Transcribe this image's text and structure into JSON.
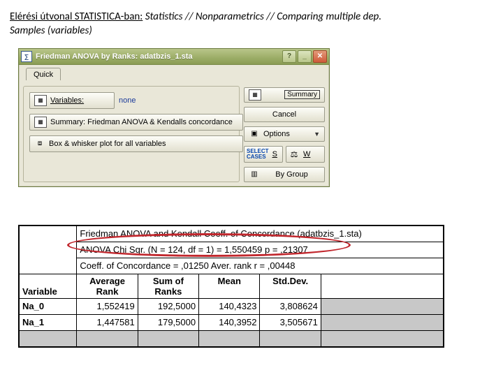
{
  "heading": {
    "lead": "Elérési útvonal STATISTICA-ban:",
    "path": " Statistics // Nonparametrics // Comparing multiple dep.",
    "path2": "Samples (variables)"
  },
  "dialog": {
    "title": "Friedman ANOVA by Ranks: adatbzis_1.sta",
    "tab": "Quick",
    "variables_btn": "Variables:",
    "variables_value": "none",
    "summary_btn": "Summary: Friedman ANOVA & Kendalls concordance",
    "whisker_btn": "Box & whisker plot for all variables",
    "right": {
      "summary": "Summary",
      "cancel": "Cancel",
      "options": "Options",
      "s": "S",
      "w": "W",
      "bygroup": "By Group"
    }
  },
  "results": {
    "title_line": "Friedman ANOVA and Kendall Coeff. of Concordance (adatbzis_1.sta)",
    "stat_line": "ANOVA Chi Sqr. (N = 124, df = 1) = 1,550459 p = ,21307",
    "coeff_line": "Coeff. of Concordance = ,01250 Aver. rank r = ,00448",
    "variable_label": "Variable",
    "columns": {
      "avg_rank1": "Average",
      "avg_rank2": "Rank",
      "sum1": "Sum of",
      "sum2": "Ranks",
      "mean": "Mean",
      "std": "Std.Dev."
    },
    "rows": [
      {
        "name": "Na_0",
        "avg_rank": "1,552419",
        "sum": "192,5000",
        "mean": "140,4323",
        "std": "3,808624"
      },
      {
        "name": "Na_1",
        "avg_rank": "1,447581",
        "sum": "179,5000",
        "mean": "140,3952",
        "std": "3,505671"
      }
    ]
  }
}
